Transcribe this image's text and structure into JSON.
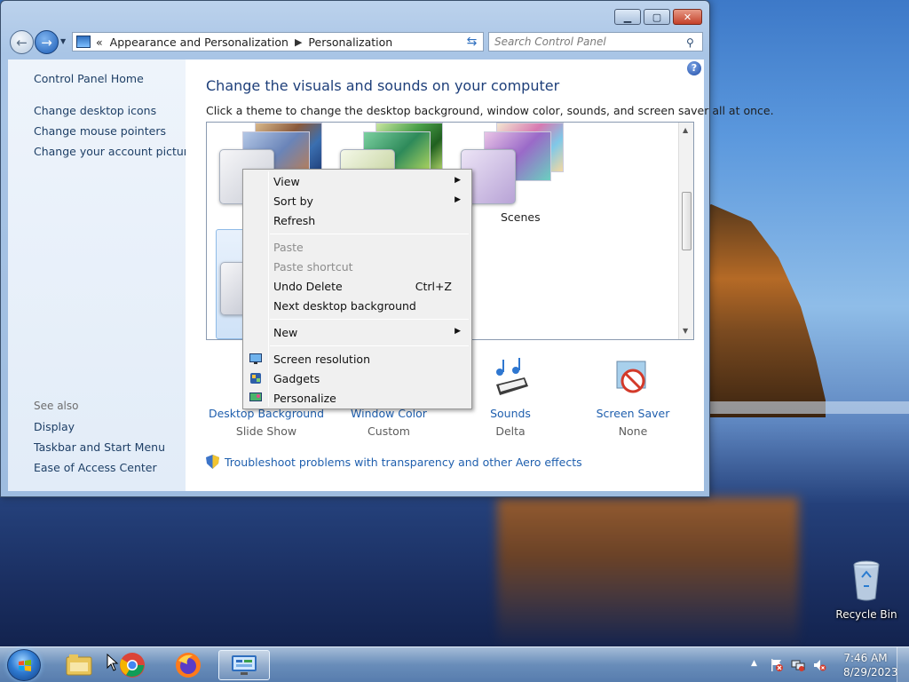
{
  "window": {
    "address_parent": "Appearance and Personalization",
    "address_current": "Personalization",
    "address_overflow": "«",
    "search_placeholder": "Search Control Panel"
  },
  "sidebar": {
    "home": "Control Panel Home",
    "links": [
      "Change desktop icons",
      "Change mouse pointers",
      "Change your account picture"
    ],
    "see_also": "See also",
    "see_also_links": [
      "Display",
      "Taskbar and Start Menu",
      "Ease of Access Center"
    ]
  },
  "main": {
    "title": "Change the visuals and sounds on your computer",
    "description": "Click a theme to change the desktop background, window color, sounds, and screen saver all at once.",
    "themes": [
      {
        "label": "Scenes"
      }
    ],
    "settings": [
      {
        "label": "Desktop Background",
        "value": "Slide Show"
      },
      {
        "label": "Window Color",
        "value": "Custom"
      },
      {
        "label": "Sounds",
        "value": "Delta"
      },
      {
        "label": "Screen Saver",
        "value": "None"
      }
    ],
    "troubleshoot": "Troubleshoot problems with transparency and other Aero effects"
  },
  "context_menu": {
    "view": "View",
    "sort_by": "Sort by",
    "refresh": "Refresh",
    "paste": "Paste",
    "paste_shortcut": "Paste shortcut",
    "undo_delete": "Undo Delete",
    "undo_shortcut": "Ctrl+Z",
    "next_background": "Next desktop background",
    "new": "New",
    "screen_resolution": "Screen resolution",
    "gadgets": "Gadgets",
    "personalize": "Personalize"
  },
  "desktop": {
    "recycle_bin": "Recycle Bin"
  },
  "taskbar": {
    "time": "7:46 AM",
    "date": "8/29/2023",
    "pinned": [
      "file-explorer-icon",
      "chrome-icon",
      "firefox-icon",
      "control-panel-icon"
    ]
  },
  "colors": {
    "link": "#1f5fae",
    "title": "#1e3f7a",
    "menu_bg": "#f0f0f0"
  }
}
